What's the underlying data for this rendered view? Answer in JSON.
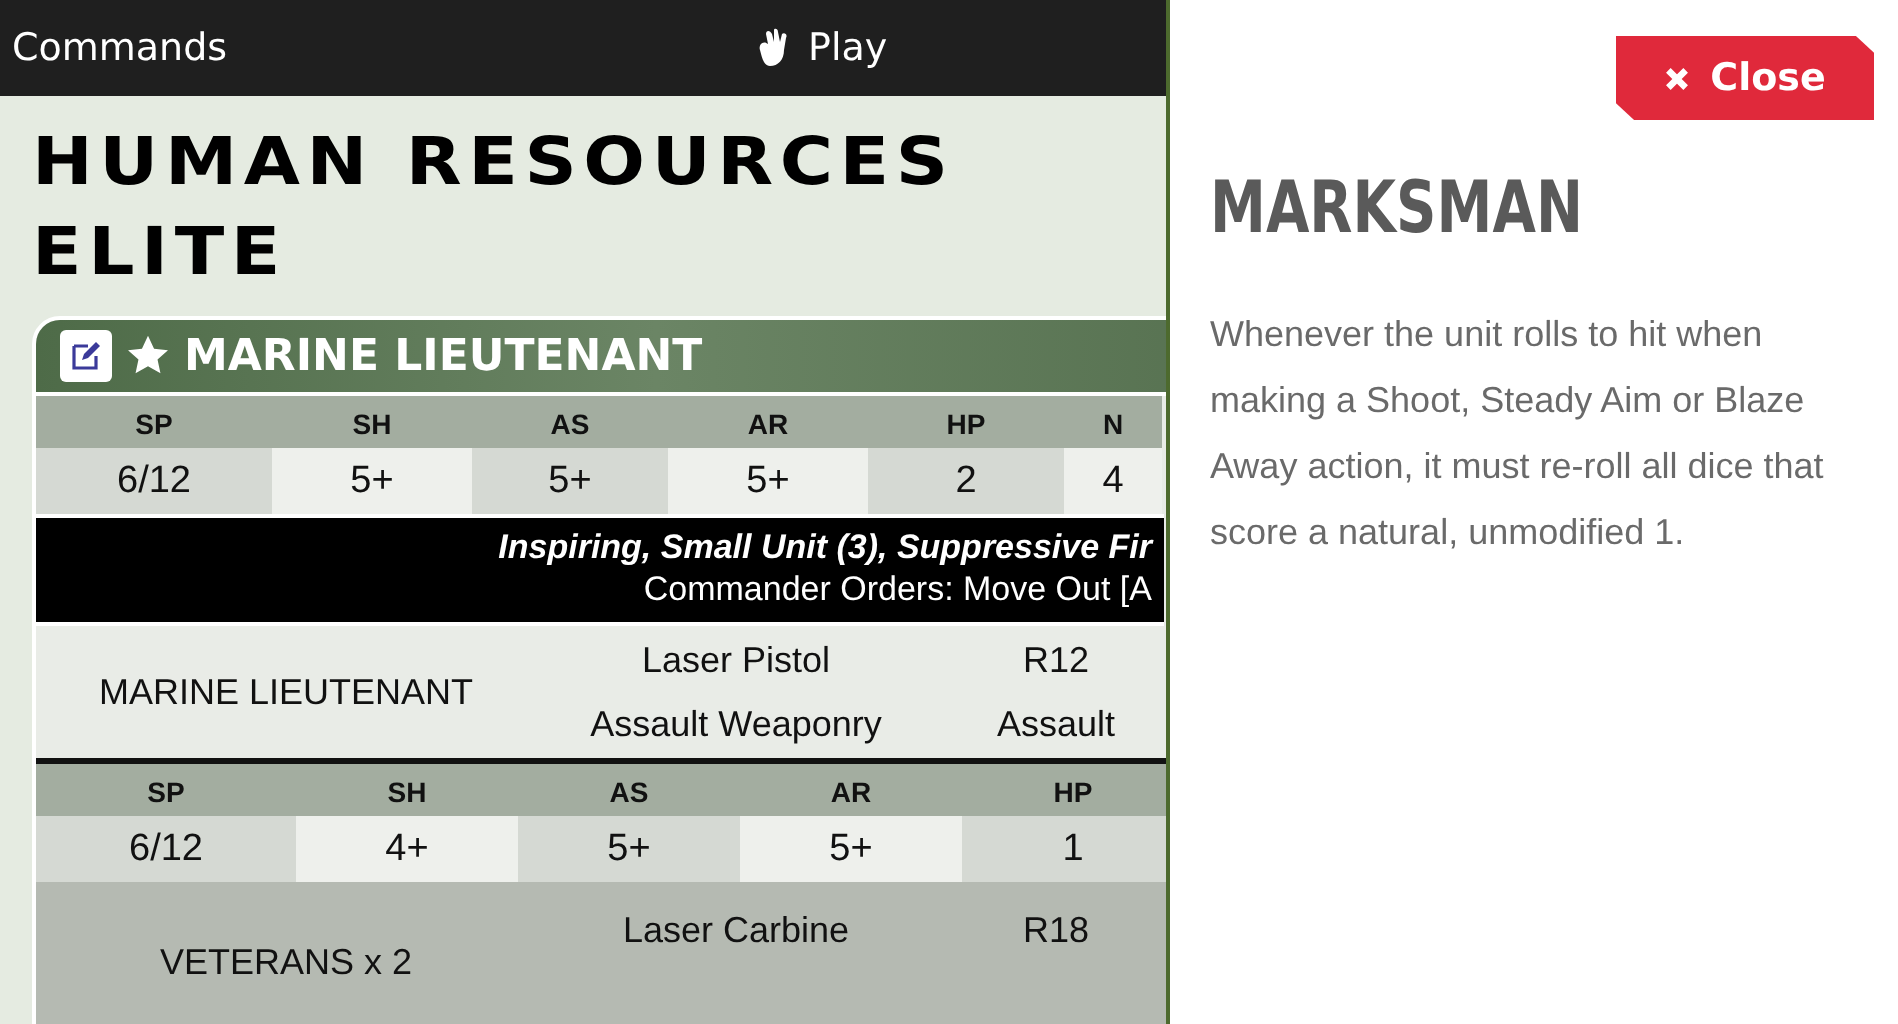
{
  "top_bar": {
    "left_label": "Commands",
    "play_label": "Play"
  },
  "roster": {
    "title_lines": [
      "HUMAN RESOURCES",
      "ELITE"
    ],
    "unit_card": {
      "name": "MARINE LIEUTENANT",
      "stat_tables": [
        {
          "headers": [
            "SP",
            "SH",
            "AS",
            "AR",
            "HP",
            "N"
          ],
          "values": [
            "6/12",
            "5+",
            "5+",
            "5+",
            "2",
            "4"
          ]
        },
        {
          "headers": [
            "SP",
            "SH",
            "AS",
            "AR",
            "HP"
          ],
          "values": [
            "6/12",
            "4+",
            "5+",
            "5+",
            "1"
          ]
        }
      ],
      "special_rules": [
        "Inspiring, Small Unit (3), Suppressive Fir",
        "Commander Orders: Move Out [A"
      ],
      "models": [
        {
          "name": "MARINE LIEUTENANT",
          "weapons": [
            "Laser Pistol",
            "Assault Weaponry"
          ],
          "ranges": [
            "R12",
            "Assault"
          ]
        },
        {
          "name": "VETERANS x 2",
          "weapons": [
            "Laser Carbine"
          ],
          "ranges": [
            "R18"
          ]
        }
      ]
    }
  },
  "panel": {
    "close_label": "Close",
    "title": "MARKSMAN",
    "text": "Whenever the unit rolls to hit when making a Shoot, Steady Aim or Blaze Away action, it must re-roll all dice that score a natural, unmodified 1."
  }
}
